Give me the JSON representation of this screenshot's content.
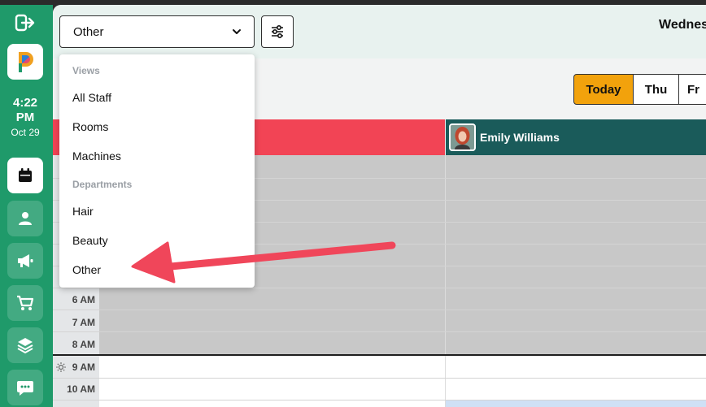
{
  "app": {
    "accent": "#1f9a6a"
  },
  "sidebar": {
    "time": "4:22",
    "ampm": "PM",
    "date": "Oct 29",
    "icons": [
      "exit-icon",
      "app-logo",
      "calendar-icon",
      "person-icon",
      "megaphone-icon",
      "cart-icon",
      "layers-icon",
      "chat-icon"
    ]
  },
  "toolbar": {
    "view_select_value": "Other",
    "date_heading": "Wednes"
  },
  "nav": {
    "today": "Today",
    "thu": "Thu",
    "fri": "Fr"
  },
  "dropdown": {
    "views_heading": "Views",
    "views": [
      "All Staff",
      "Rooms",
      "Machines"
    ],
    "departments_heading": "Departments",
    "departments": [
      "Hair",
      "Beauty",
      "Other"
    ]
  },
  "staff": [
    {
      "name": "",
      "color": "#f24455"
    },
    {
      "name": "Emily Williams",
      "color": "#1a5b5a"
    }
  ],
  "times": [
    "6 AM",
    "7 AM",
    "8 AM",
    "9 AM",
    "10 AM"
  ],
  "annotation": {
    "color": "#f0465a"
  }
}
